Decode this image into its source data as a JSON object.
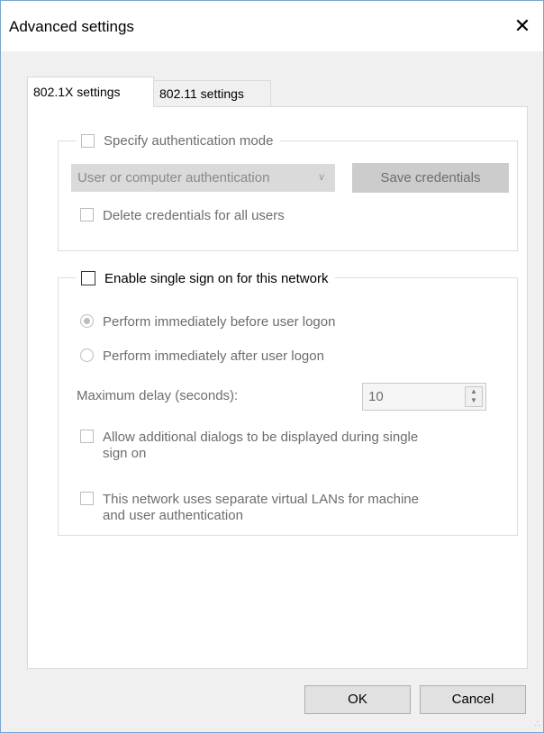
{
  "window": {
    "title": "Advanced settings",
    "close_glyph": "✕"
  },
  "tabs": [
    {
      "label": "802.1X settings",
      "active": true
    },
    {
      "label": "802.11 settings",
      "active": false
    }
  ],
  "auth_group": {
    "specify_mode_label": "Specify authentication mode",
    "specify_mode_checked": false,
    "mode_select_value": "User or computer authentication",
    "save_credentials_label": "Save credentials",
    "delete_credentials_label": "Delete credentials for all users",
    "delete_credentials_checked": false
  },
  "sso_group": {
    "enable_label": "Enable single sign on for this network",
    "enable_checked": false,
    "radio_before_label": "Perform immediately before user logon",
    "radio_before_selected": true,
    "radio_after_label": "Perform immediately after user logon",
    "radio_after_selected": false,
    "max_delay_label": "Maximum delay (seconds):",
    "max_delay_value": "10",
    "allow_dialogs_label_line1": "Allow additional dialogs to be displayed during single",
    "allow_dialogs_label_line2": "sign on",
    "vlan_label_line1": "This network uses separate virtual LANs for machine",
    "vlan_label_line2": "and user authentication"
  },
  "footer": {
    "ok_label": "OK",
    "cancel_label": "Cancel"
  }
}
